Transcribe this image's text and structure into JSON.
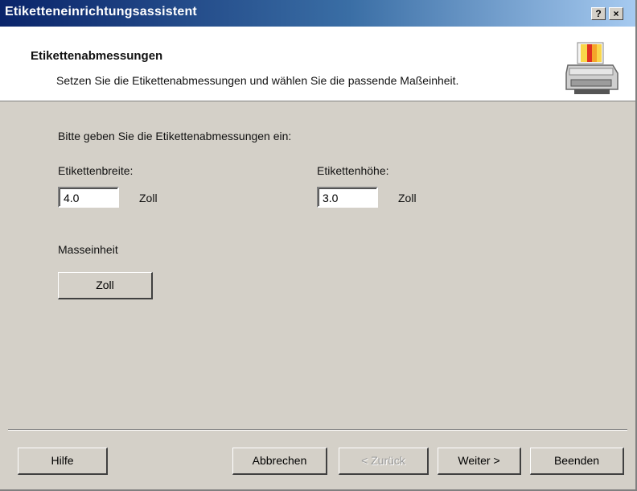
{
  "window": {
    "title": "Etiketteneinrichtungsassistent",
    "help_btn": "?",
    "close_btn": "×"
  },
  "header": {
    "title": "Etikettenabmessungen",
    "subtitle": "Setzen Sie die Etikettenabmessungen und wählen Sie die passende Maßeinheit."
  },
  "form": {
    "instruction": "Bitte geben Sie die Etikettenabmessungen ein:",
    "width_label": "Etikettenbreite:",
    "width_value": "4.0",
    "width_unit": "Zoll",
    "height_label": "Etikettenhöhe:",
    "height_value": "3.0",
    "height_unit": "Zoll",
    "unit_label": "Masseinheit",
    "unit_button": "Zoll"
  },
  "buttons": {
    "help": "Hilfe",
    "cancel": "Abbrechen",
    "back": "< Zurück",
    "next": "Weiter >",
    "finish": "Beenden"
  }
}
